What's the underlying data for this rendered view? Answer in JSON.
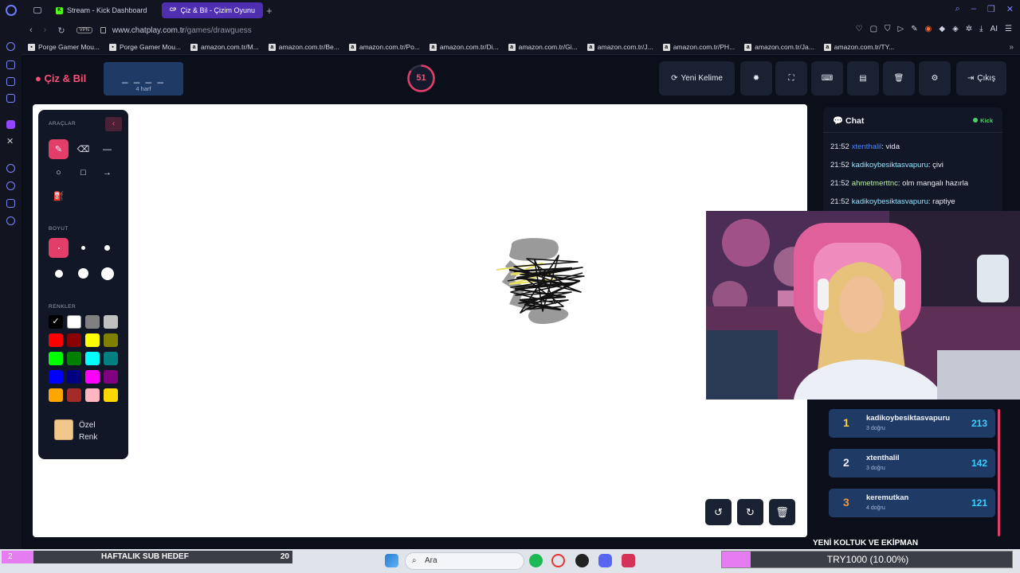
{
  "browser": {
    "tabs": [
      {
        "label": "Stream - Kick Dashboard",
        "favicon": "K",
        "color": "#53fc18"
      },
      {
        "label": "Çiz & Bil - Çizim Oyunu",
        "favicon": "CP",
        "color": "#ffffff"
      }
    ],
    "address": {
      "host": "www.chatplay.com.tr",
      "path": "/games/drawguess",
      "vpn": "VPN"
    },
    "ai_label": "AI",
    "bookmarks": [
      "Porge Gamer Mou...",
      "Porge Gamer Mou...",
      "amazon.com.tr/M...",
      "amazon.com.tr/Be...",
      "amazon.com.tr/Po...",
      "amazon.com.tr/Di...",
      "amazon.com.tr/Gi...",
      "amazon.com.tr/J...",
      "amazon.com.tr/PH...",
      "amazon.com.tr/Ja...",
      "amazon.com.tr/TY..."
    ]
  },
  "game": {
    "brand": "Çiz & Bil",
    "word_mask": "_ _ _ _",
    "word_length": "4 harf",
    "timer": "51",
    "timer_progress": 0.85,
    "header_buttons": {
      "new_word": "Yeni Kelime",
      "exit": "Çıkış"
    }
  },
  "toolbox": {
    "tools_label": "ARAÇLAR",
    "size_label": "BOYUT",
    "colors_label": "RENKLER",
    "custom_color_label": "Özel Renk",
    "custom_color": "#f1c78a",
    "colors": [
      "#000000",
      "#ffffff",
      "#808080",
      "#c0c0c0",
      "#ff0000",
      "#8b0000",
      "#ffff00",
      "#808000",
      "#00ff00",
      "#008000",
      "#00ffff",
      "#008080",
      "#0000ff",
      "#000080",
      "#ff00ff",
      "#800080",
      "#ffa500",
      "#a52a2a",
      "#ffb6c1",
      "#ffd700"
    ]
  },
  "chat": {
    "title": "Chat",
    "platform": "Kick",
    "messages": [
      {
        "time": "21:52",
        "user": "xtenthalil",
        "user_color": "#4a86ff",
        "text": ": vida"
      },
      {
        "time": "21:52",
        "user": "kadikoybesiktasvapuru",
        "user_color": "#8fe3ff",
        "text": ": çivi"
      },
      {
        "time": "21:52",
        "user": "ahmetmerttnc",
        "user_color": "#b7f2a3",
        "text": ": olm mangalı hazırla"
      },
      {
        "time": "21:52",
        "user": "kadikoybesiktasvapuru",
        "user_color": "#8fe3ff",
        "text": ": raptiye"
      }
    ]
  },
  "leaderboard": [
    {
      "rank": "1",
      "name": "kadikoybesiktasvapuru",
      "sub": "3 doğru",
      "score": "213",
      "rank_color": "#ffd23f"
    },
    {
      "rank": "2",
      "name": "xtenthalil",
      "sub": "3 doğru",
      "score": "142",
      "rank_color": "#e8ecf5"
    },
    {
      "rank": "3",
      "name": "keremutkan",
      "sub": "4 doğru",
      "score": "121",
      "rank_color": "#f09a3e"
    }
  ],
  "overlay": {
    "promo": "YENİ KOLTUK VE EKİPMAN",
    "sub_goal_label": "HAFTALIK SUB HEDEF",
    "sub_goal_current": "2",
    "sub_goal_target": "20",
    "donation": "TRY1000 (10.00%)"
  },
  "taskbar": {
    "search_placeholder": "Ara"
  }
}
